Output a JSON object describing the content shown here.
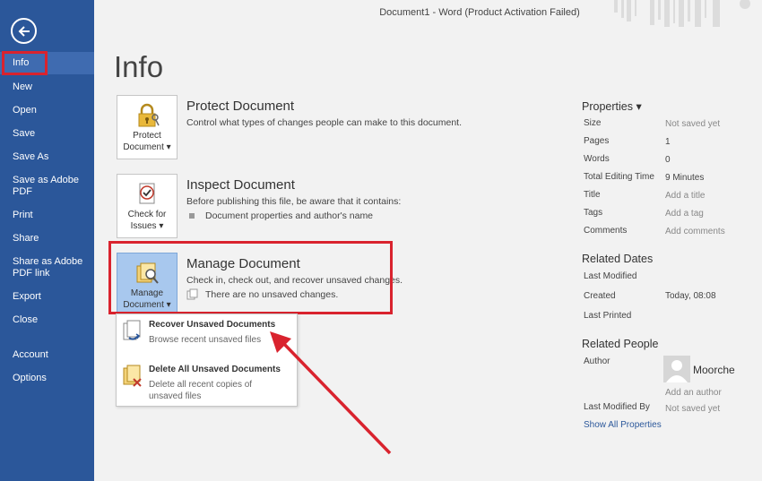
{
  "window": {
    "title": "Document1 - Word (Product Activation Failed)"
  },
  "sidebar": {
    "items": [
      {
        "label": "Info"
      },
      {
        "label": "New"
      },
      {
        "label": "Open"
      },
      {
        "label": "Save"
      },
      {
        "label": "Save As"
      },
      {
        "label": "Save as Adobe\nPDF"
      },
      {
        "label": "Print"
      },
      {
        "label": "Share"
      },
      {
        "label": "Share as Adobe\nPDF link"
      },
      {
        "label": "Export"
      },
      {
        "label": "Close"
      },
      {
        "label": "Account"
      },
      {
        "label": "Options"
      }
    ]
  },
  "page": {
    "title": "Info"
  },
  "protect": {
    "tile_label": "Protect\nDocument ▾",
    "title": "Protect Document",
    "desc": "Control what types of changes people can make to this document."
  },
  "inspect": {
    "tile_label": "Check for\nIssues ▾",
    "title": "Inspect Document",
    "desc": "Before publishing this file, be aware that it contains:",
    "bullet": "Document properties and author's name"
  },
  "manage": {
    "tile_label": "Manage\nDocument ▾",
    "title": "Manage Document",
    "desc": "Check in, check out, and recover unsaved changes.",
    "bullet": "There are no unsaved changes."
  },
  "dropdown": {
    "items": [
      {
        "title": "Recover Unsaved Documents",
        "desc": "Browse recent unsaved files"
      },
      {
        "title": "Delete All Unsaved Documents",
        "desc": "Delete all recent copies of\nunsaved files"
      }
    ]
  },
  "properties": {
    "heading": "Properties ▾",
    "rows": [
      {
        "label": "Size",
        "value": "Not saved yet"
      },
      {
        "label": "Pages",
        "value": "1"
      },
      {
        "label": "Words",
        "value": "0"
      },
      {
        "label": "Total Editing Time",
        "value": "9 Minutes"
      },
      {
        "label": "Title",
        "value": "Add a title"
      },
      {
        "label": "Tags",
        "value": "Add a tag"
      },
      {
        "label": "Comments",
        "value": "Add comments"
      }
    ]
  },
  "related_dates": {
    "heading": "Related Dates",
    "rows": [
      {
        "label": "Last Modified",
        "value": ""
      },
      {
        "label": "Created",
        "value": "Today, 08:08"
      },
      {
        "label": "Last Printed",
        "value": ""
      }
    ]
  },
  "related_people": {
    "heading": "Related People",
    "author_label": "Author",
    "author_name": "Moorche",
    "add_author": "Add an author",
    "last_modified_by_label": "Last Modified By",
    "last_modified_by_value": "Not saved yet",
    "show_all": "Show All Properties"
  },
  "colors": {
    "sidebar": "#2b579a",
    "highlight": "#d9232e",
    "selected_tile": "#a8c8ee"
  },
  "icons": [
    "back-arrow-icon",
    "lock-key-icon",
    "check-document-icon",
    "manage-document-icon",
    "recover-document-icon",
    "delete-document-icon",
    "author-avatar-icon",
    "annotation-arrow-icon"
  ]
}
